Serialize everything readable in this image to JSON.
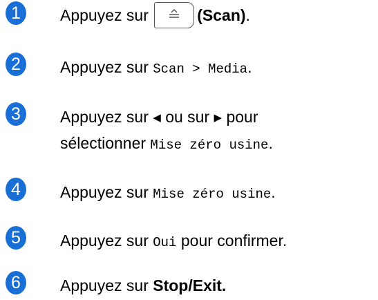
{
  "colors": {
    "badge": "#1a6fd6",
    "text": "#000000"
  },
  "steps": [
    {
      "number": "1",
      "prefix": "Appuyez sur",
      "button_icon": "scan-icon",
      "button_label": "(Scan)",
      "suffix": "."
    },
    {
      "number": "2",
      "prefix": "Appuyez sur",
      "mono": "Scan > Media",
      "suffix": "."
    },
    {
      "number": "3",
      "prefix": "Appuyez sur",
      "left_arrow": "◀",
      "middle": "ou sur",
      "right_arrow": "▶",
      "after": "pour",
      "line2_prefix": "sélectionner",
      "mono": "Mise zéro usine",
      "suffix": "."
    },
    {
      "number": "4",
      "prefix": "Appuyez sur",
      "mono": "Mise zéro usine",
      "suffix": "."
    },
    {
      "number": "5",
      "prefix": "Appuyez sur",
      "mono": "Oui",
      "after": "pour confirmer."
    },
    {
      "number": "6",
      "prefix": "Appuyez sur",
      "bold": "Stop/Exit",
      "suffix": "."
    }
  ]
}
